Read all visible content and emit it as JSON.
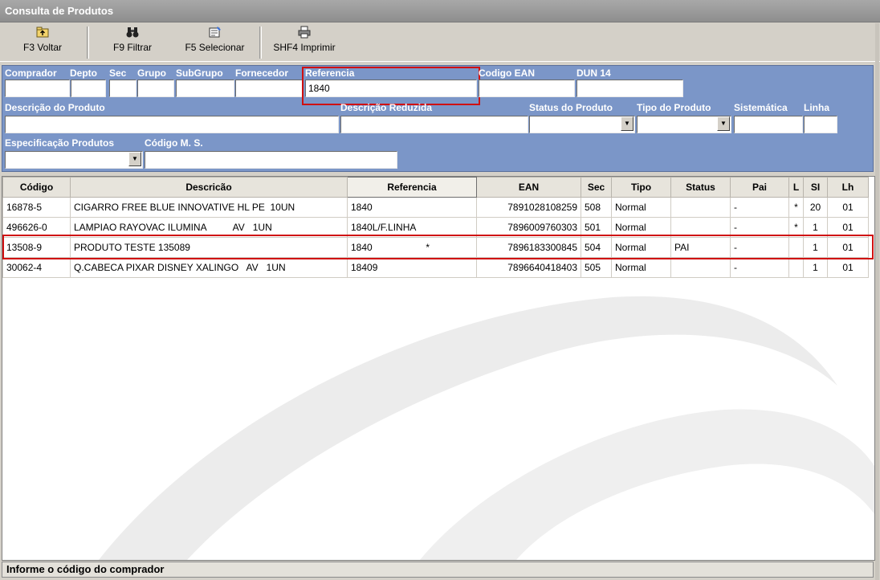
{
  "window": {
    "title": "Consulta de Produtos"
  },
  "toolbar": {
    "buttons": [
      {
        "icon": "back-folder-icon",
        "label": "F3 Voltar"
      },
      {
        "icon": "binoculars-icon",
        "label": "F9 Filtrar"
      },
      {
        "icon": "select-icon",
        "label": "F5 Selecionar"
      },
      {
        "icon": "printer-icon",
        "label": "SHF4 Imprimir"
      }
    ]
  },
  "filters": {
    "comprador": {
      "label": "Comprador",
      "value": ""
    },
    "depto": {
      "label": "Depto",
      "value": ""
    },
    "sec": {
      "label": "Sec",
      "value": ""
    },
    "grupo": {
      "label": "Grupo",
      "value": ""
    },
    "subgrupo": {
      "label": "SubGrupo",
      "value": ""
    },
    "fornecedor": {
      "label": "Fornecedor",
      "value": ""
    },
    "referencia": {
      "label": "Referencia",
      "value": "1840"
    },
    "codigo_ean": {
      "label": "Codigo EAN",
      "value": ""
    },
    "dun14": {
      "label": "DUN 14",
      "value": ""
    },
    "descricao_produto": {
      "label": "Descrição do Produto",
      "value": ""
    },
    "descricao_reduzida": {
      "label": "Descrição Reduzida",
      "value": ""
    },
    "status_produto": {
      "label": "Status do Produto",
      "value": ""
    },
    "tipo_produto": {
      "label": "Tipo do Produto",
      "value": ""
    },
    "sistematica": {
      "label": "Sistemática",
      "value": ""
    },
    "linha": {
      "label": "Linha",
      "value": ""
    },
    "especificacao": {
      "label": "Especificação Produtos",
      "value": ""
    },
    "codigo_ms": {
      "label": "Código M. S.",
      "value": ""
    }
  },
  "grid": {
    "columns": [
      "Código",
      "Descricão",
      "Referencia",
      "EAN",
      "Sec",
      "Tipo",
      "Status",
      "Pai",
      "L",
      "SI",
      "Lh"
    ],
    "rows": [
      [
        "16878-5",
        "CIGARRO FREE BLUE INNOVATIVE HL PE  10UN",
        "1840",
        "7891028108259",
        "508",
        "Normal",
        "",
        "-",
        "*",
        "20",
        "01"
      ],
      [
        "496626-0",
        "LAMPIAO RAYOVAC ILUMINA          AV   1UN",
        "1840L/F.LINHA",
        "7896009760303",
        "501",
        "Normal",
        "",
        "-",
        "*",
        "1",
        "01"
      ],
      [
        "13508-9",
        "PRODUTO TESTE 135089",
        "1840                    *",
        "7896183300845",
        "504",
        "Normal",
        "PAI",
        "-",
        "",
        "1",
        "01"
      ],
      [
        "30062-4",
        "Q.CABECA PIXAR DISNEY XALINGO   AV   1UN",
        "18409",
        "7896640418403",
        "505",
        "Normal",
        "",
        "-",
        "",
        "1",
        "01"
      ]
    ]
  },
  "status_bar": {
    "message": "Informe o código do comprador"
  },
  "colors": {
    "filter_bg": "#7b96c8",
    "highlight": "#d01010",
    "title_bg": "#999999"
  }
}
